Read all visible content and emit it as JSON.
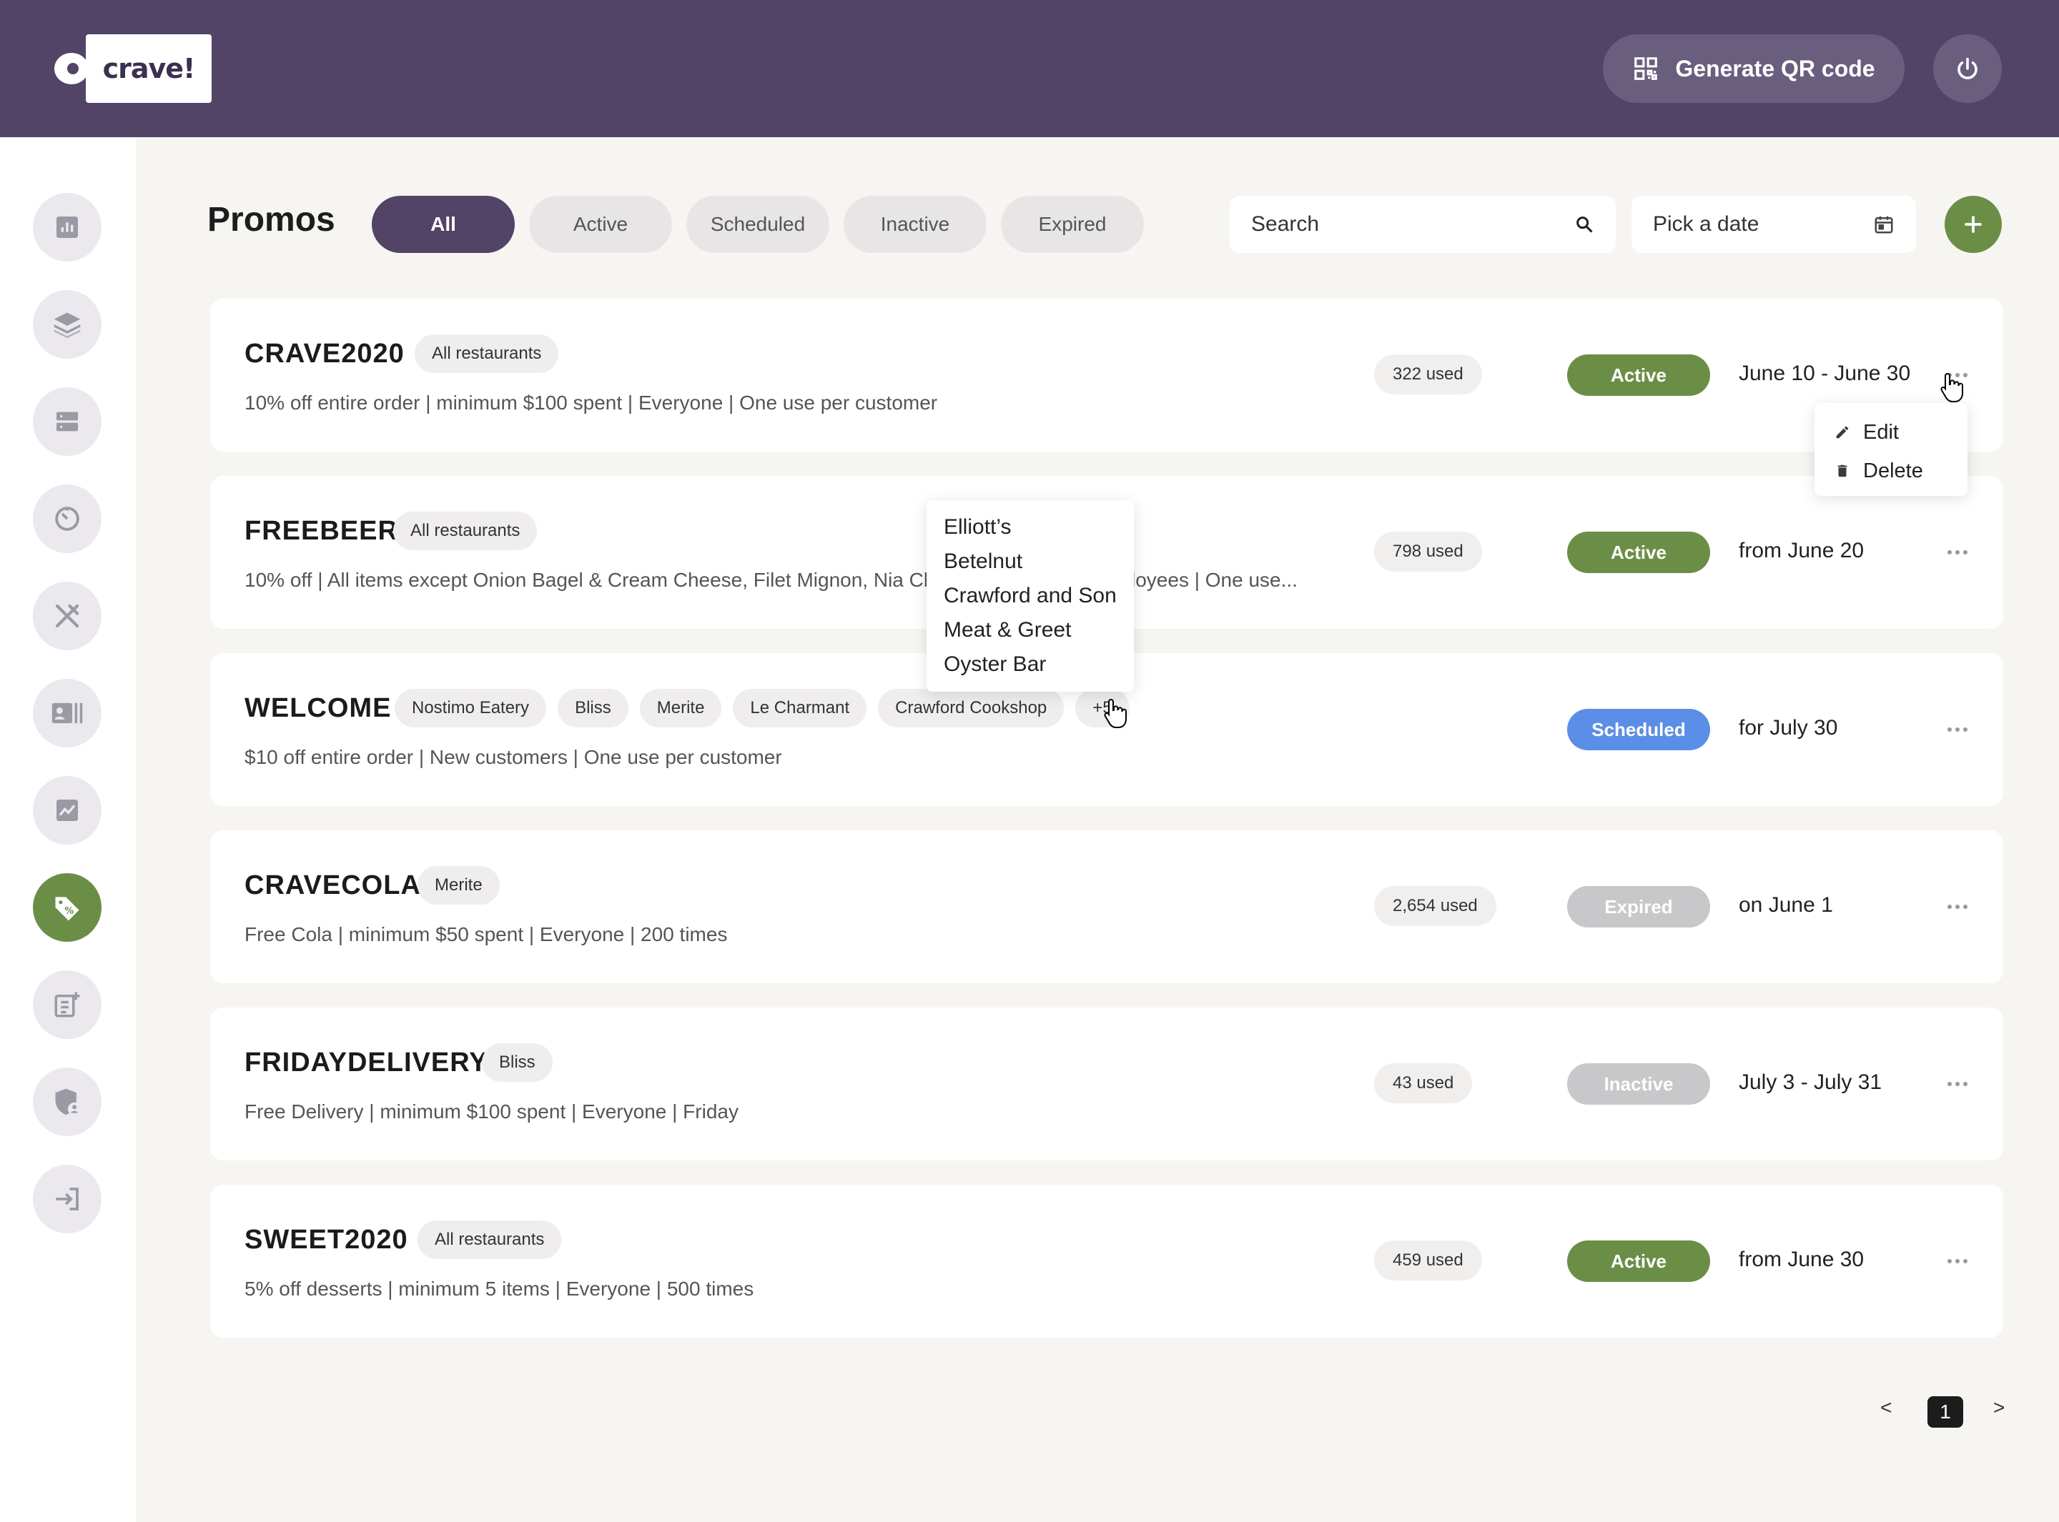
{
  "app": {
    "logo_text": "crave!"
  },
  "header": {
    "qr_label": "Generate QR code"
  },
  "sidebar": {
    "items": [
      "dashboard-icon",
      "layers-icon",
      "server-icon",
      "timer-icon",
      "utensils-icon",
      "contacts-icon",
      "analytics-icon",
      "promo-tag-icon",
      "note-add-icon",
      "shield-user-icon",
      "sign-in-icon"
    ]
  },
  "page": {
    "title": "Promos"
  },
  "tabs": [
    "All",
    "Active",
    "Scheduled",
    "Inactive",
    "Expired"
  ],
  "search": {
    "placeholder": "Search"
  },
  "date_picker": {
    "placeholder": "Pick a date"
  },
  "colors": {
    "header": "#514467",
    "green": "#6b8e47",
    "blue": "#5b8ee6",
    "gray": "#c8c7c9"
  },
  "promos": [
    {
      "code": "CRAVE2020",
      "tags": [
        "All restaurants"
      ],
      "description": "10% off entire order | minimum $100 spent | Everyone | One use per customer",
      "used": "322 used",
      "status": "Active",
      "dates": "June 10 - June 30"
    },
    {
      "code": "FREEBEER",
      "tags": [
        "All restaurants"
      ],
      "description": "10% off | All items except Onion Bagel & Cream Cheese, Filet Mignon, Nia Cl",
      "description_tail": "loyees | One use...",
      "used": "798 used",
      "status": "Active",
      "dates": "from June 20"
    },
    {
      "code": "WELCOME",
      "tags": [
        "Nostimo Eatery",
        "Bliss",
        "Merite",
        "Le Charmant",
        "Crawford Cookshop",
        "+5"
      ],
      "description": "$10 off entire order | New customers | One use per customer",
      "used": "",
      "status": "Scheduled",
      "dates": "for July 30"
    },
    {
      "code": "CRAVECOLA",
      "tags": [
        "Merite"
      ],
      "description": "Free Cola | minimum $50 spent | Everyone | 200 times",
      "used": "2,654 used",
      "status": "Expired",
      "dates": "on June 1"
    },
    {
      "code": "FRIDAYDELIVERY",
      "tags": [
        "Bliss"
      ],
      "description": "Free Delivery | minimum $100 spent | Everyone | Friday",
      "used": "43 used",
      "status": "Inactive",
      "dates": "July 3 - July 31"
    },
    {
      "code": "SWEET2020",
      "tags": [
        "All restaurants"
      ],
      "description": "5% off desserts | minimum 5 items | Everyone | 500 times",
      "used": "459 used",
      "status": "Active",
      "dates": "from June 30"
    }
  ],
  "restaurant_popup": [
    "Elliott’s",
    "Betelnut",
    "Crawford and Son",
    "Meat & Greet",
    "Oyster Bar"
  ],
  "action_menu": {
    "edit": "Edit",
    "delete": "Delete"
  },
  "pagination": {
    "prev": "<",
    "current": "1",
    "next": ">"
  }
}
